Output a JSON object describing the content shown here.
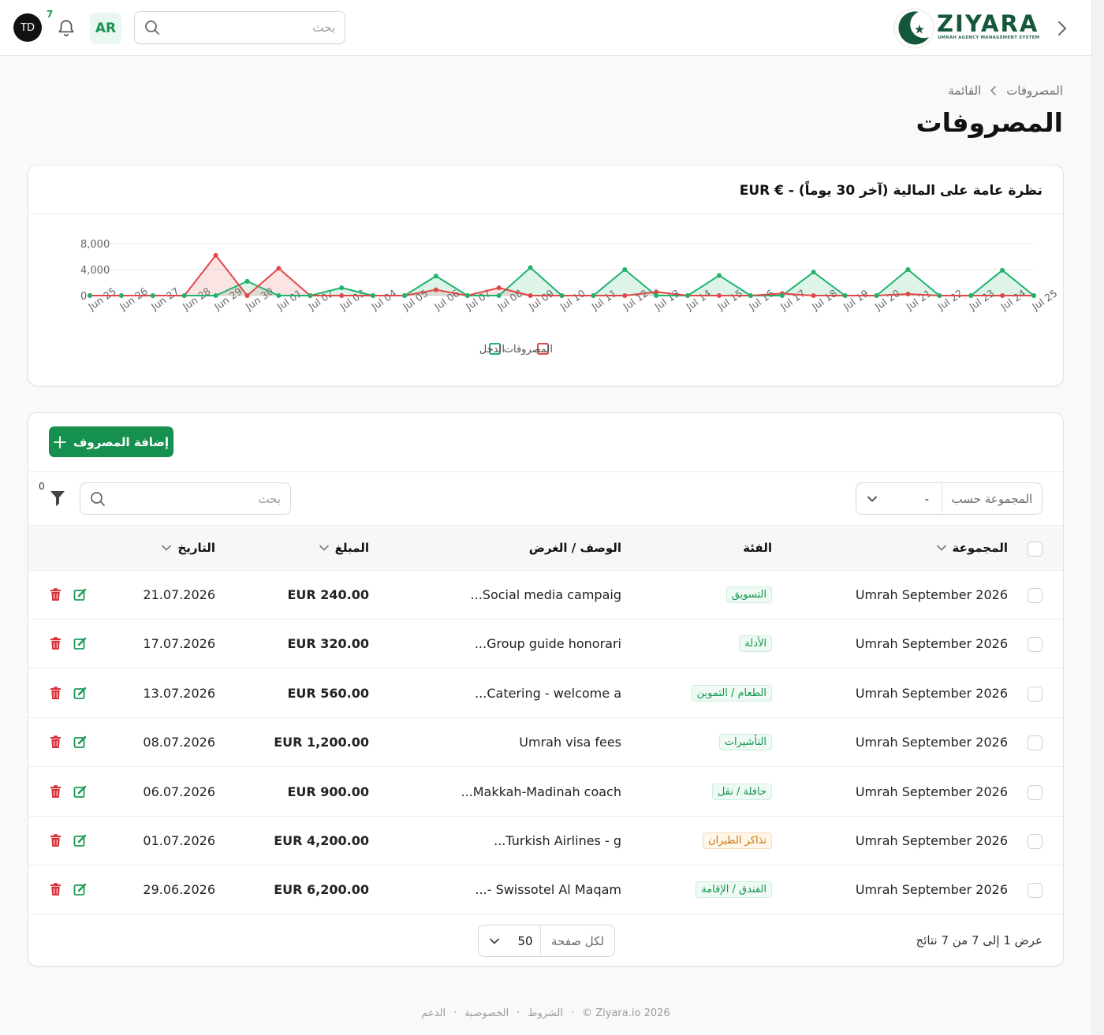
{
  "header": {
    "logo_text": "ZIYARA",
    "logo_tagline": "UMRAH AGENCY MANAGEMENT SYSTEM",
    "search_placeholder": "بحث",
    "language": "AR",
    "notification_count": "7",
    "avatar_initials": "TD"
  },
  "breadcrumb": {
    "items": [
      "المصروفات",
      "القائمة"
    ]
  },
  "page": {
    "title": "المصروفات"
  },
  "chart_card": {
    "title": "نظرة عامة على المالية (آخر 30 يوماً) - € EUR"
  },
  "chart_data": {
    "type": "area",
    "x": [
      "Jun 25",
      "Jun 26",
      "Jun 27",
      "Jun 28",
      "Jun 29",
      "Jun 30",
      "Jul 01",
      "Jul 02",
      "Jul 03",
      "Jul 04",
      "Jul 05",
      "Jul 06",
      "Jul 07",
      "Jul 08",
      "Jul 09",
      "Jul 10",
      "Jul 11",
      "Jul 12",
      "Jul 13",
      "Jul 14",
      "Jul 15",
      "Jul 16",
      "Jul 17",
      "Jul 18",
      "Jul 19",
      "Jul 20",
      "Jul 21",
      "Jul 22",
      "Jul 23",
      "Jul 24",
      "Jul 25"
    ],
    "yticks": [
      "8,000",
      "4,000",
      "0"
    ],
    "ylim": [
      0,
      8000
    ],
    "series": [
      {
        "name": "الدخل",
        "color": "#1fb36b",
        "values": [
          0,
          0,
          0,
          0,
          0,
          2200,
          0,
          0,
          1200,
          0,
          0,
          3000,
          0,
          0,
          4300,
          0,
          0,
          4000,
          0,
          0,
          3100,
          0,
          0,
          3600,
          0,
          0,
          4000,
          0,
          0,
          3900,
          0
        ]
      },
      {
        "name": "المصروفات",
        "color": "#df4848",
        "values": [
          0,
          0,
          0,
          0,
          6200,
          0,
          4200,
          0,
          0,
          0,
          0,
          900,
          0,
          1200,
          0,
          0,
          0,
          0,
          560,
          0,
          0,
          0,
          320,
          0,
          0,
          0,
          240,
          0,
          0,
          0,
          0
        ]
      }
    ],
    "legend": "bottom-center",
    "grid": true
  },
  "toolbar": {
    "add_label": "إضافة المصروف",
    "group_by_label": "المجموعة حسب",
    "group_by_value": "-",
    "search_placeholder": "بحث",
    "filter_count": "0"
  },
  "table": {
    "headers": {
      "group": "المجموعة",
      "category": "الفئة",
      "description": "الوصف / الغرض",
      "amount": "المبلغ",
      "date": "التاريخ"
    },
    "rows": [
      {
        "group": "Umrah September 2026",
        "category": "التسويق",
        "cat_color": "#15944f",
        "cat_bg": "#eefaf3",
        "description": "Social media campaig...",
        "amount": "EUR 240.00",
        "date": "21.07.2026"
      },
      {
        "group": "Umrah September 2026",
        "category": "الأدلة",
        "cat_color": "#15944f",
        "cat_bg": "#eefaf3",
        "description": "Group guide honorari...",
        "amount": "EUR 320.00",
        "date": "17.07.2026"
      },
      {
        "group": "Umrah September 2026",
        "category": "الطعام / التموين",
        "cat_color": "#15944f",
        "cat_bg": "#eefaf3",
        "description": "Catering - welcome a...",
        "amount": "EUR 560.00",
        "date": "13.07.2026"
      },
      {
        "group": "Umrah September 2026",
        "category": "التأشيرات",
        "cat_color": "#15944f",
        "cat_bg": "#eefaf3",
        "description": "Umrah visa fees",
        "amount": "EUR 1,200.00",
        "date": "08.07.2026"
      },
      {
        "group": "Umrah September 2026",
        "category": "حافلة / نقل",
        "cat_color": "#15944f",
        "cat_bg": "#eefaf3",
        "description": "Makkah-Madinah coach...",
        "amount": "EUR 900.00",
        "date": "06.07.2026"
      },
      {
        "group": "Umrah September 2026",
        "category": "تذاكر الطيران",
        "cat_color": "#c8730f",
        "cat_bg": "#fff6ea",
        "description": "Turkish Airlines - g...",
        "amount": "EUR 4,200.00",
        "date": "01.07.2026"
      },
      {
        "group": "Umrah September 2026",
        "category": "الفندق / الإقامة",
        "cat_color": "#15944f",
        "cat_bg": "#eefaf3",
        "description": "Swissotel Al Maqam -...",
        "amount": "EUR 6,200.00",
        "date": "29.06.2026"
      }
    ]
  },
  "pagination": {
    "summary": "عرض 1 إلى 7 من 7 نتائج",
    "per_page_label": "لكل صفحة",
    "per_page_value": "50"
  },
  "footer": {
    "copyright": "© Ziyara.io 2026",
    "terms": "الشروط",
    "privacy": "الخصوصية",
    "support": "الدعم",
    "separator": "·"
  }
}
